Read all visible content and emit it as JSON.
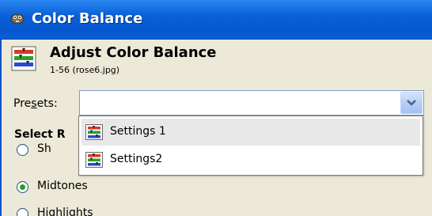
{
  "window": {
    "title": "Color Balance"
  },
  "header": {
    "title": "Adjust Color Balance",
    "subtitle": "1-56 (rose6.jpg)"
  },
  "presets": {
    "label_pre": "Pre",
    "label_mnemonic": "s",
    "label_post": "ets:",
    "value": ""
  },
  "select_range": {
    "label": "Select R"
  },
  "ranges": [
    {
      "label": "Sh",
      "checked": false
    },
    {
      "label": "Midtones",
      "checked": true
    },
    {
      "label": "Highlights",
      "checked": false
    }
  ],
  "dropdown": {
    "items": [
      {
        "label": "Settings 1",
        "hovered": true,
        "icon": "color-balance-icon"
      },
      {
        "label": "Settings2",
        "hovered": false,
        "icon": "color-balance-icon"
      }
    ]
  },
  "colors": {
    "titlebar": "#0a60d8",
    "panel": "#ece9d8",
    "radio_checked": "#21a121"
  }
}
